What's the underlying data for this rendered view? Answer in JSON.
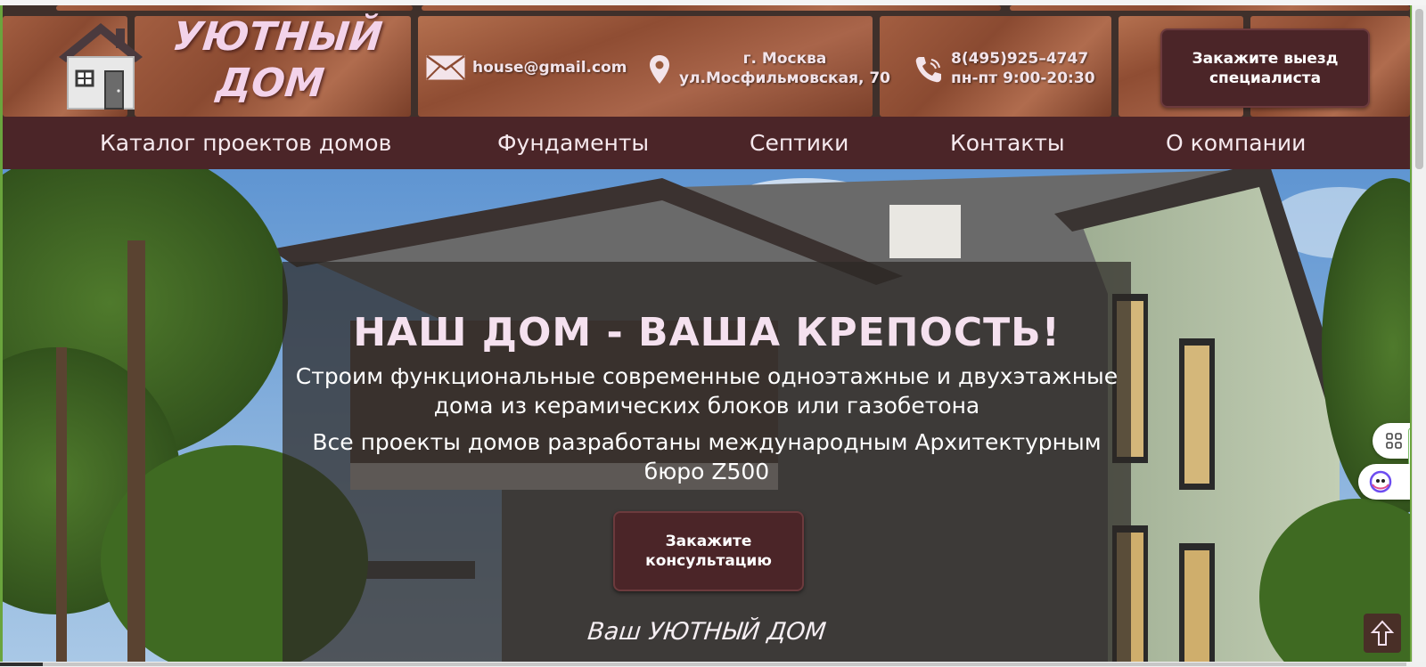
{
  "header": {
    "logo_text": "УЮТНЫЙ ДОМ",
    "email": "house@gmail.com",
    "address": {
      "city": "г. Москва",
      "street": "ул.Мосфильмовская, 70"
    },
    "phone": {
      "number": "8(495)925–4747",
      "hours": "пн-пт 9:00-20:30"
    },
    "order_visit_button": "Закажите выезд специалиста"
  },
  "nav": {
    "items": [
      {
        "label": "Каталог проектов домов"
      },
      {
        "label": "Фундаменты"
      },
      {
        "label": "Септики"
      },
      {
        "label": "Контакты"
      },
      {
        "label": "О компании"
      }
    ]
  },
  "hero": {
    "title": "НАШ ДОМ - ВАША КРЕПОСТЬ!",
    "text_1": "Строим функциональные современные одноэтажные и двухэтажные дома из керамических блоков или газобетона",
    "text_2": "Все проекты домов разработаны международным Архитектурным бюро Z500",
    "consult_button": "Закажите консультацию",
    "tagline": "Ваш УЮТНЫЙ ДОМ"
  },
  "icons": {
    "logo": "house-logo-icon",
    "email": "envelope-icon",
    "address": "map-pin-icon",
    "phone": "phone-icon",
    "widget_grid": "grid-icon",
    "widget_assistant": "assistant-icon",
    "scroll_top": "arrow-up-icon"
  },
  "colors": {
    "brand": "#4b2528",
    "text_light": "#f5e1ef",
    "brick": "#9a5a3d",
    "overlay": "#2d2826"
  }
}
